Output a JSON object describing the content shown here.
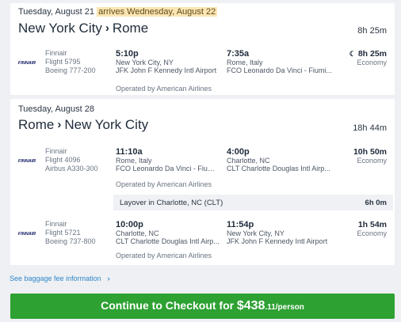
{
  "outbound": {
    "date": "Tuesday, August 21",
    "arrives_note": "arrives Wednesday, August 22",
    "origin": "New York City",
    "destination": "Rome",
    "separator": "›",
    "total_duration": "8h 25m",
    "segments": [
      {
        "airline": "Finnair",
        "flight": "Flight 5795",
        "aircraft": "Boeing 777-200",
        "dep_time": "5:10p",
        "dep_city": "New York City, NY",
        "dep_airport": "JFK John F Kennedy Intl Airport",
        "arr_time": "7:35a",
        "arr_city": "Rome, Italy",
        "arr_airport": "FCO Leonardo Da Vinci - Fiumi...",
        "duration": "8h 25m",
        "overnight_icon": "moon-icon",
        "cabin": "Economy",
        "operated_by": "Operated by American Airlines"
      }
    ]
  },
  "return": {
    "date": "Tuesday, August 28",
    "origin": "Rome",
    "destination": "New York City",
    "separator": "›",
    "total_duration": "18h 44m",
    "segments": [
      {
        "airline": "Finnair",
        "flight": "Flight 4096",
        "aircraft": "Airbus A330-300",
        "dep_time": "11:10a",
        "dep_city": "Rome, Italy",
        "dep_airport": "FCO Leonardo Da Vinci - Fiumi...",
        "arr_time": "4:00p",
        "arr_city": "Charlotte, NC",
        "arr_airport": "CLT Charlotte Douglas Intl Airp...",
        "duration": "10h 50m",
        "cabin": "Economy",
        "operated_by": "Operated by American Airlines"
      },
      {
        "airline": "Finnair",
        "flight": "Flight 5721",
        "aircraft": "Boeing 737-800",
        "dep_time": "10:00p",
        "dep_city": "Charlotte, NC",
        "dep_airport": "CLT Charlotte Douglas Intl Airp...",
        "arr_time": "11:54p",
        "arr_city": "New York City, NY",
        "arr_airport": "JFK John F Kennedy Intl Airport",
        "duration": "1h 54m",
        "cabin": "Economy",
        "operated_by": "Operated by American Airlines"
      }
    ],
    "layover": {
      "label": "Layover in Charlotte, NC (CLT)",
      "duration": "6h 0m"
    }
  },
  "baggage_link": "See baggage fee information",
  "checkout": {
    "label": "Continue to Checkout for",
    "price": "$438",
    "cents": ".11",
    "per": "/person"
  },
  "colors": {
    "accent_green": "#2da132",
    "link_blue": "#2f86c9",
    "highlight": "#fbe6b3",
    "finnair_blue": "#0b1560"
  }
}
